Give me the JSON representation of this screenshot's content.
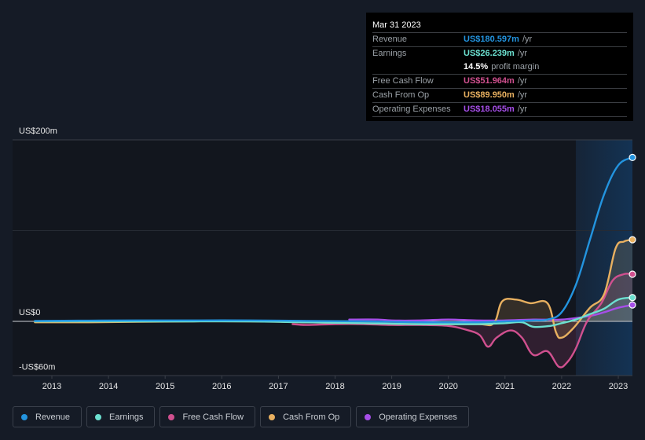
{
  "tooltip": {
    "date": "Mar 31 2023",
    "rows": [
      {
        "label": "Revenue",
        "value": "US$180.597m",
        "unit": "/yr",
        "color": "#2394df"
      },
      {
        "label": "Earnings",
        "value": "US$26.239m",
        "unit": "/yr",
        "color": "#6ce0d0"
      },
      {
        "label": "",
        "value": "14.5%",
        "unit": "profit margin",
        "color": "#ffffff"
      },
      {
        "label": "Free Cash Flow",
        "value": "US$51.964m",
        "unit": "/yr",
        "color": "#d0508f"
      },
      {
        "label": "Cash From Op",
        "value": "US$89.950m",
        "unit": "/yr",
        "color": "#e8b060"
      },
      {
        "label": "Operating Expenses",
        "value": "US$18.055m",
        "unit": "/yr",
        "color": "#a64ee8"
      }
    ]
  },
  "legend": [
    {
      "label": "Revenue",
      "color": "#2394df"
    },
    {
      "label": "Earnings",
      "color": "#6ce0d0"
    },
    {
      "label": "Free Cash Flow",
      "color": "#d0508f"
    },
    {
      "label": "Cash From Op",
      "color": "#e8b060"
    },
    {
      "label": "Operating Expenses",
      "color": "#a64ee8"
    }
  ],
  "chart_data": {
    "type": "line",
    "title": "",
    "xlabel": "",
    "ylabel": "",
    "y_tick_labels": [
      "US$200m",
      "US$0",
      "-US$60m"
    ],
    "y_ticks": [
      200,
      0,
      -60
    ],
    "ylim": [
      -60,
      200
    ],
    "xlim": [
      2012.3,
      2023.25
    ],
    "x_tick_labels": [
      "2013",
      "2014",
      "2015",
      "2016",
      "2017",
      "2018",
      "2019",
      "2020",
      "2021",
      "2022",
      "2023"
    ],
    "x_ticks": [
      2013,
      2014,
      2015,
      2016,
      2017,
      2018,
      2019,
      2020,
      2021,
      2022,
      2023
    ],
    "grid": true,
    "highlight_region": [
      2022.25,
      2023.25
    ],
    "legend_position": "bottom",
    "series": [
      {
        "name": "Revenue",
        "color": "#2394df",
        "fill": false,
        "points": [
          [
            2012.7,
            0.5
          ],
          [
            2013.5,
            0.8
          ],
          [
            2014.5,
            1
          ],
          [
            2015.5,
            1
          ],
          [
            2016.5,
            1
          ],
          [
            2017.5,
            0.5
          ],
          [
            2018.5,
            0
          ],
          [
            2019.5,
            -1
          ],
          [
            2020.5,
            -1
          ],
          [
            2021.0,
            0
          ],
          [
            2021.5,
            1
          ],
          [
            2021.75,
            2
          ],
          [
            2022.0,
            10
          ],
          [
            2022.25,
            40
          ],
          [
            2022.5,
            90
          ],
          [
            2022.75,
            140
          ],
          [
            2023.0,
            172
          ],
          [
            2023.25,
            180.597
          ]
        ]
      },
      {
        "name": "Earnings",
        "color": "#6ce0d0",
        "fill": true,
        "points": [
          [
            2012.7,
            0
          ],
          [
            2013.5,
            0
          ],
          [
            2014.5,
            0
          ],
          [
            2015.5,
            0
          ],
          [
            2016.5,
            0
          ],
          [
            2017.5,
            -1
          ],
          [
            2018.5,
            -2
          ],
          [
            2019.5,
            -3
          ],
          [
            2020.5,
            -3
          ],
          [
            2021.0,
            -2
          ],
          [
            2021.3,
            -1
          ],
          [
            2021.5,
            -6
          ],
          [
            2021.8,
            -5
          ],
          [
            2022.0,
            -2
          ],
          [
            2022.25,
            2
          ],
          [
            2022.5,
            8
          ],
          [
            2022.75,
            14
          ],
          [
            2023.0,
            24
          ],
          [
            2023.25,
            26.239
          ]
        ]
      },
      {
        "name": "Free Cash Flow",
        "color": "#d0508f",
        "fill": true,
        "points": [
          [
            2017.25,
            -3
          ],
          [
            2017.5,
            -4
          ],
          [
            2018.0,
            -3
          ],
          [
            2018.5,
            -3
          ],
          [
            2019.0,
            -4
          ],
          [
            2019.5,
            -4
          ],
          [
            2020.0,
            -5
          ],
          [
            2020.3,
            -9
          ],
          [
            2020.55,
            -15
          ],
          [
            2020.7,
            -28
          ],
          [
            2020.85,
            -18
          ],
          [
            2021.1,
            -10
          ],
          [
            2021.3,
            -18
          ],
          [
            2021.5,
            -37
          ],
          [
            2021.75,
            -33
          ],
          [
            2021.95,
            -50
          ],
          [
            2022.1,
            -45
          ],
          [
            2022.25,
            -30
          ],
          [
            2022.45,
            0
          ],
          [
            2022.7,
            20
          ],
          [
            2022.9,
            45
          ],
          [
            2023.1,
            52
          ],
          [
            2023.25,
            51.964
          ]
        ]
      },
      {
        "name": "Cash From Op",
        "color": "#e8b060",
        "fill": true,
        "points": [
          [
            2012.7,
            -1
          ],
          [
            2013.5,
            -1
          ],
          [
            2014.5,
            -0.5
          ],
          [
            2015.5,
            0
          ],
          [
            2016.5,
            0
          ],
          [
            2017.5,
            -1
          ],
          [
            2018.5,
            -2
          ],
          [
            2019.5,
            -3
          ],
          [
            2020.5,
            -3
          ],
          [
            2020.8,
            -2
          ],
          [
            2020.95,
            22
          ],
          [
            2021.2,
            24
          ],
          [
            2021.45,
            20
          ],
          [
            2021.75,
            20
          ],
          [
            2021.9,
            -12
          ],
          [
            2022.0,
            -18
          ],
          [
            2022.2,
            -8
          ],
          [
            2022.5,
            15
          ],
          [
            2022.75,
            30
          ],
          [
            2022.95,
            80
          ],
          [
            2023.1,
            88
          ],
          [
            2023.25,
            89.95
          ]
        ]
      },
      {
        "name": "Operating Expenses",
        "color": "#a64ee8",
        "fill": false,
        "points": [
          [
            2018.25,
            2
          ],
          [
            2018.75,
            2
          ],
          [
            2019.0,
            1
          ],
          [
            2019.5,
            1
          ],
          [
            2020.0,
            2
          ],
          [
            2020.5,
            1
          ],
          [
            2021.0,
            1
          ],
          [
            2021.5,
            2
          ],
          [
            2022.0,
            2
          ],
          [
            2022.5,
            6
          ],
          [
            2022.75,
            10
          ],
          [
            2023.0,
            15
          ],
          [
            2023.25,
            18.055
          ]
        ]
      }
    ]
  }
}
